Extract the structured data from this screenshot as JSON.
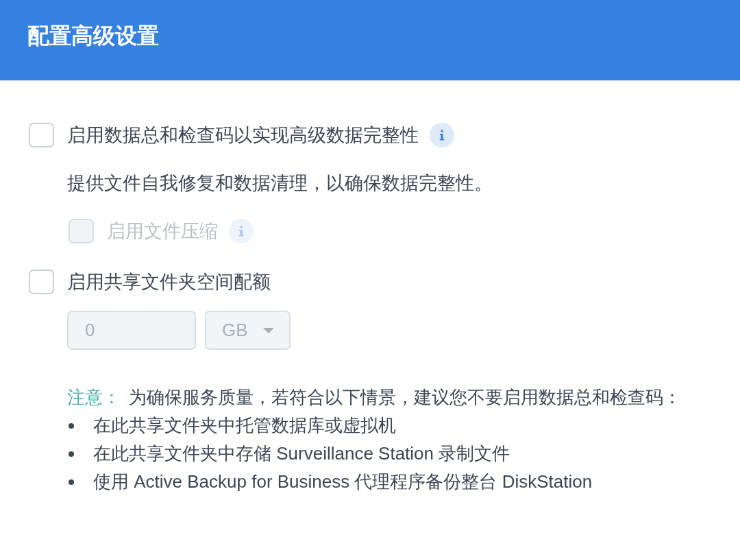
{
  "dialog": {
    "title": "配置高级设置"
  },
  "options": [
    {
      "kind": "checkbox",
      "label": "启用数据总和检查码以实现高级数据完整性",
      "checked": false,
      "disabled": false,
      "info": true,
      "description": "提供文件自我修复和数据清理，以确保数据完整性。",
      "children": [
        {
          "kind": "checkbox",
          "label": "启用文件压缩",
          "checked": false,
          "disabled": true,
          "info": true
        }
      ]
    },
    {
      "kind": "checkbox",
      "label": "启用共享文件夹空间配额",
      "checked": false,
      "disabled": false,
      "quota": {
        "value": "0",
        "unit": "GB",
        "disabled": true
      }
    }
  ],
  "note": {
    "label": "注意：",
    "text": "为确保服务质量，若符合以下情景，建议您不要启用数据总和检查码：",
    "items": [
      "在此共享文件夹中托管数据库或虚拟机",
      "在此共享文件夹中存储 Surveillance Station 录制文件",
      "使用 Active Backup for Business 代理程序备份整台 DiskStation"
    ]
  }
}
